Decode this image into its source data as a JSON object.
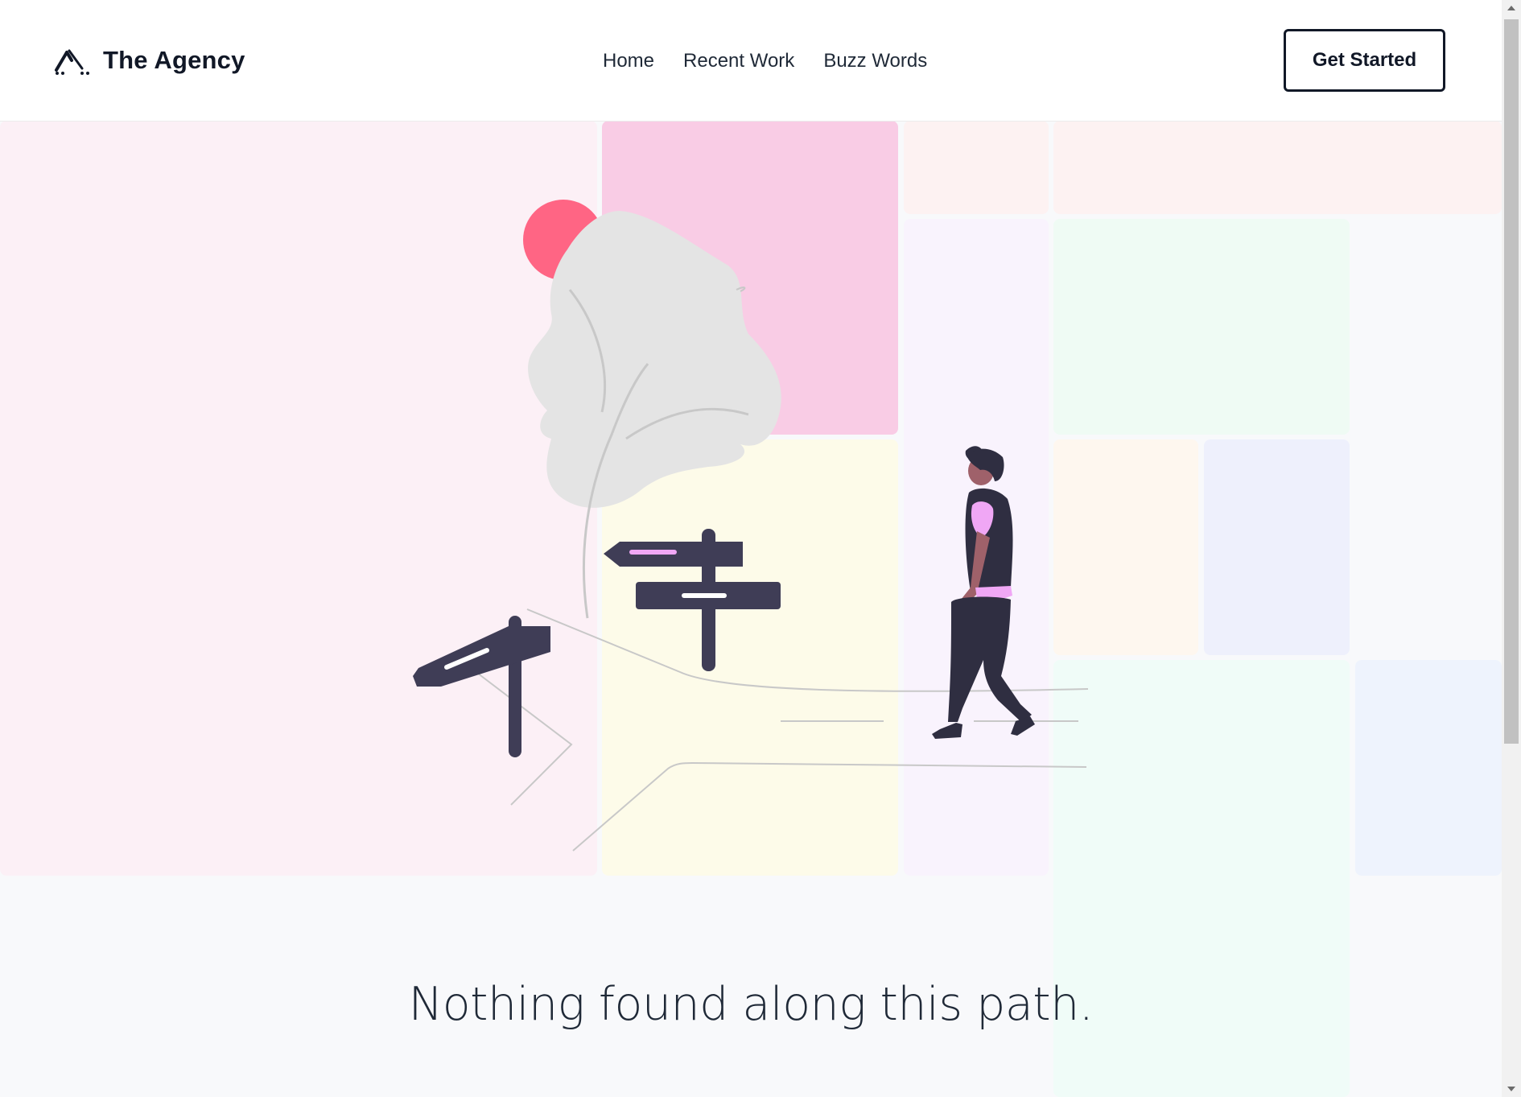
{
  "header": {
    "brand_name": "The Agency",
    "logo_icon": "agency-peak-logo-icon",
    "nav": [
      {
        "label": "Home"
      },
      {
        "label": "Recent Work"
      },
      {
        "label": "Buzz Words"
      }
    ],
    "cta_label": "Get Started"
  },
  "main": {
    "message": "Nothing found along this path.",
    "illustration": "lost-person-signpost-illustration"
  },
  "colors": {
    "accent_pink": "#ff6584",
    "signpost": "#3f3d56",
    "sign_highlight": "#f0a7f5",
    "tile_pink": "#fcf0f6",
    "tile_pink_strong": "#f9cce5",
    "tile_yellow": "#fdfbe9",
    "tile_lavender": "#f9f3fd",
    "tile_green": "#effbf4",
    "tile_blue": "#eef0fc",
    "text": "#111827"
  }
}
